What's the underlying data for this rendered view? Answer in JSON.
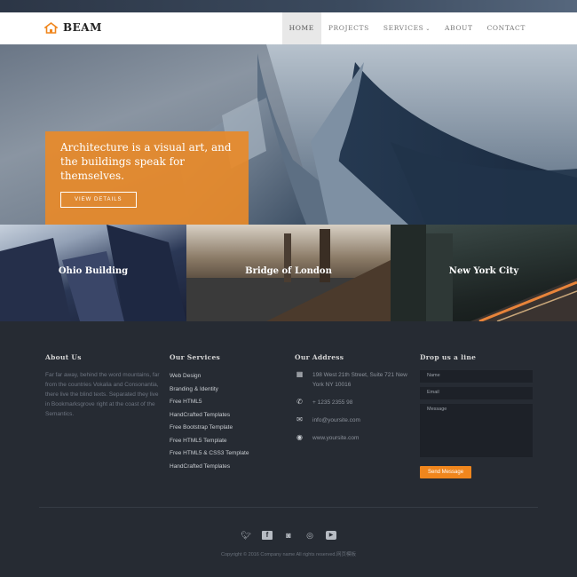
{
  "brand": {
    "name": "BEAM",
    "accent": "#f0861d"
  },
  "nav": {
    "items": [
      {
        "label": "HOME",
        "active": true
      },
      {
        "label": "PROJECTS"
      },
      {
        "label": "SERVICES"
      },
      {
        "label": "ABOUT"
      },
      {
        "label": "CONTACT"
      }
    ]
  },
  "hero": {
    "headline": "Architecture is a visual art, and the buildings speak for themselves.",
    "button": "VIEW DETAILS"
  },
  "gallery": [
    {
      "caption": "Ohio Building"
    },
    {
      "caption": "Bridge of London"
    },
    {
      "caption": "New York City"
    }
  ],
  "footer": {
    "about": {
      "title": "About Us",
      "text": "Far far away, behind the word mountains, far from the countries Vokalia and Consonantia, there live the blind texts. Separated they live in Bookmarksgrove right at the coast of the Semantics."
    },
    "services": {
      "title": "Our Services",
      "items": [
        "Web Design",
        "Branding & Identity",
        "Free HTML5",
        "HandCrafted Templates",
        "Free Bootstrap Template",
        "Free HTML5 Template",
        "Free HTML5 & CSS3 Template",
        "HandCrafted Templates"
      ]
    },
    "address": {
      "title": "Our Address",
      "street": "198 West 21th Street, Suite 721 New York NY 10016",
      "phone": "+ 1235 2355 98",
      "email": "info@yoursite.com",
      "website": "www.yoursite.com"
    },
    "form": {
      "title": "Drop us a line",
      "name_placeholder": "Name",
      "email_placeholder": "Email",
      "message_placeholder": "Message",
      "send_label": "Send Message"
    },
    "social_icons": [
      "twitter-icon",
      "facebook-icon",
      "instagram-icon",
      "dribbble-icon",
      "youtube-icon"
    ],
    "copyright": "Copyright © 2016 Company name All rights reserved.网页模板"
  }
}
